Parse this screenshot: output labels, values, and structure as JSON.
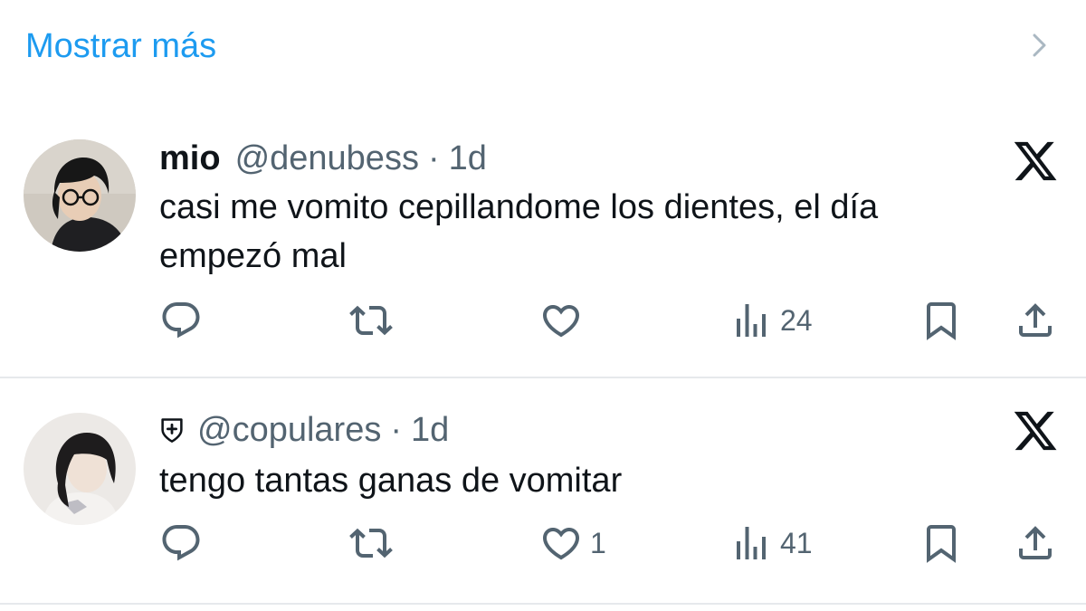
{
  "show_more": {
    "label": "Mostrar más"
  },
  "tweets": [
    {
      "name": "mio",
      "handle": "@denubess",
      "separator": "·",
      "time": "1d",
      "text": "casi me vomito cepillandome los dientes, el día empezó mal",
      "avatar": "person-with-glasses-avatar",
      "actions": {
        "reply_count": "",
        "repost_count": "",
        "like_count": "",
        "views_count": "24"
      }
    },
    {
      "name": "",
      "handle": "@copulares",
      "separator": "·",
      "time": "1d",
      "text": "tengo tantas ganas de vomitar",
      "avatar": "person-long-hair-avatar",
      "badge_icon": "shield-plus-icon",
      "actions": {
        "reply_count": "",
        "repost_count": "",
        "like_count": "1",
        "views_count": "41"
      }
    }
  ],
  "colors": {
    "accent": "#1d9bf0",
    "text": "#0f1419",
    "secondary": "#536471",
    "divider": "#e6e9ec"
  },
  "icons": [
    "chevron-right-icon",
    "x-logo-icon",
    "reply-icon",
    "repost-icon",
    "like-icon",
    "views-icon",
    "bookmark-icon",
    "share-icon",
    "shield-plus-icon"
  ]
}
